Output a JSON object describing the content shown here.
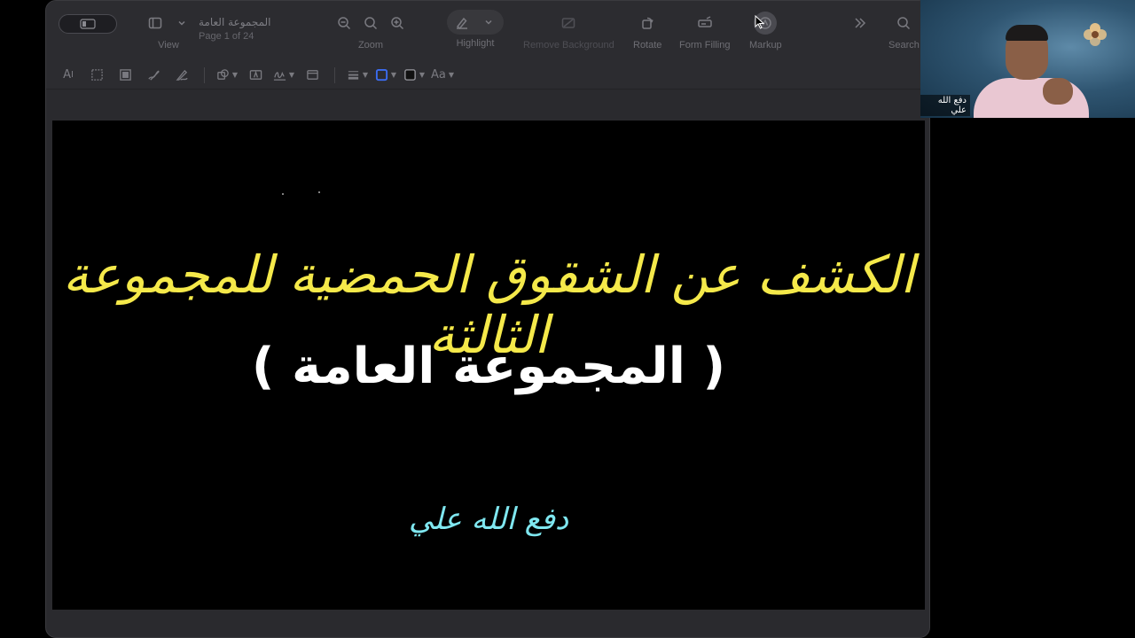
{
  "document": {
    "title": "المجموعة العامة",
    "page_indicator": "Page 1 of 24"
  },
  "toolbar": {
    "view_label": "View",
    "zoom_label": "Zoom",
    "highlight_label": "Highlight",
    "remove_background_label": "Remove Background",
    "rotate_label": "Rotate",
    "form_filling_label": "Form Filling",
    "markup_label": "Markup",
    "search_label": "Search"
  },
  "markup_bar": {
    "text_tool_label": "A",
    "font_style_label": "Aa"
  },
  "slide": {
    "title": "الكشف عن الشقوق الحمضية للمجموعة الثالثة",
    "subtitle": "( المجموعة العامة )",
    "author": "دفع الله علي"
  },
  "video": {
    "participant_name": "دفع الله علي"
  },
  "colors": {
    "title_yellow": "#f5e94a",
    "subtitle_white": "#ffffff",
    "author_cyan": "#7fe7f0",
    "accent_blue": "#3b6cf0"
  }
}
